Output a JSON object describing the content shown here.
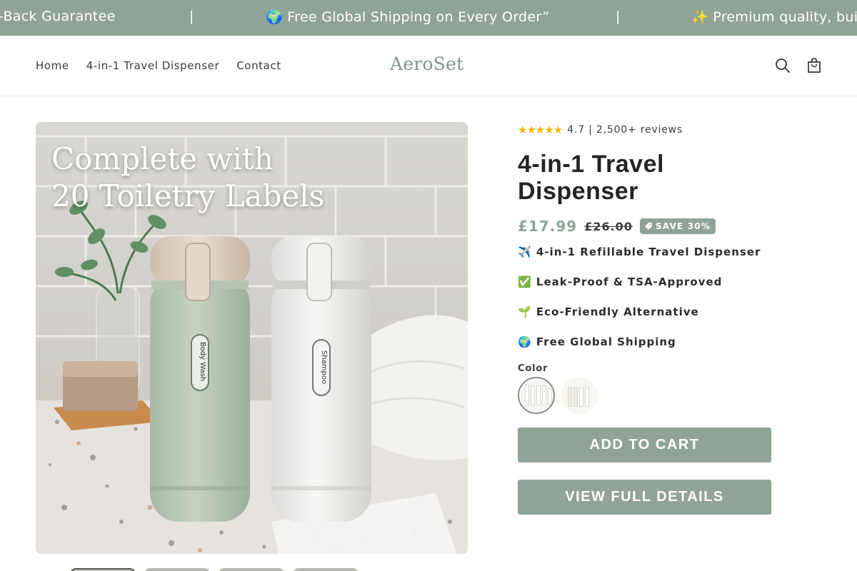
{
  "announcement": {
    "items": [
      "-Back Guarantee",
      "🌍 Free Global Shipping on Every Order”",
      "✨ Premium quality, buil"
    ],
    "separator": "|"
  },
  "header": {
    "nav": [
      "Home",
      "4-in-1 Travel Dispenser",
      "Contact"
    ],
    "logo": "AeroSet",
    "icons": [
      "search-icon",
      "cart-icon"
    ]
  },
  "product": {
    "image_caption_line1": "Complete with",
    "image_caption_line2": "20 Toiletry Labels",
    "bottle_labels": [
      "Body Wash",
      "Shampoo"
    ],
    "stars": "★★★★★",
    "rating_text": "4.7 | 2,500+ reviews",
    "title": "4-in-1 Travel Dispenser",
    "price": "£17.99",
    "compare_price": "£26.00",
    "badge": "SAVE 30%",
    "features": [
      "✈️ 4-in-1 Refillable Travel Dispenser",
      "✅ Leak-Proof & TSA-Approved",
      "🌱 Eco-Friendly Alternative",
      "🌍 Free Global Shipping"
    ],
    "color_label": "Color",
    "add_to_cart": "ADD TO CART",
    "view_details": "VIEW FULL DETAILS"
  },
  "colors": {
    "accent": "#8fa497",
    "logo": "#7f9587",
    "text": "#242424"
  }
}
